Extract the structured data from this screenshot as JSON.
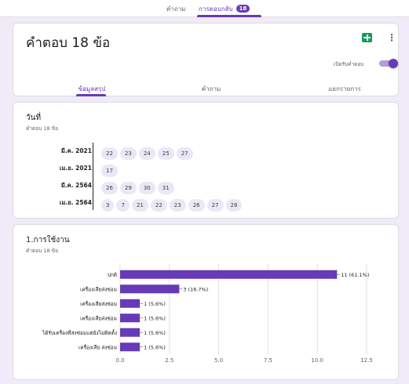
{
  "top_tabs": {
    "questions": "คำถาม",
    "responses": "การตอบกลับ",
    "responses_badge": "18"
  },
  "summary_card": {
    "title": "คำตอบ 18 ข้อ",
    "sheets_icon": "google-sheets-icon",
    "more_icon": "more-vert-icon",
    "accept_label": "เปิดรับคำตอบ",
    "accepting": true,
    "subtabs": [
      "ข้อมูลสรุป",
      "คำถาม",
      "แยกรายการ"
    ]
  },
  "date_question": {
    "title": "วันที่",
    "count": "คำตอบ 18 ข้อ",
    "rows": [
      {
        "label": "มี.ค. 2021",
        "days": [
          "22",
          "23",
          "24",
          "25",
          "27"
        ]
      },
      {
        "label": "เม.ย. 2021",
        "days": [
          "17"
        ]
      },
      {
        "label": "มี.ค. 2564",
        "days": [
          "26",
          "29",
          "30",
          "31"
        ]
      },
      {
        "label": "เม.ย. 2564",
        "days": [
          "3",
          "7",
          "21",
          "22",
          "23",
          "26",
          "27",
          "28"
        ]
      }
    ]
  },
  "usage_question": {
    "title": "1.การใช้งาน",
    "count": "คำตอบ 18 ข้อ"
  },
  "chart_data": {
    "type": "bar",
    "orientation": "horizontal",
    "categories": [
      "ปกติ",
      "เครื่องเสียส่งซ่อม",
      "เครื่องเสียส่งซ่อม",
      "เครื่องเสียส่งซ่อม",
      "ได้รับเครื่องที่ส่งซ่อมแต่ยังไม่ติดตั้ง",
      "เครื่องเสีย ส่งซ่อม"
    ],
    "values": [
      11,
      3,
      1,
      1,
      1,
      1
    ],
    "data_labels": [
      "11 (61.1%)",
      "3 (16.7%)",
      "1 (5.6%)",
      "1 (5.6%)",
      "1 (5.6%)",
      "1 (5.6%)"
    ],
    "xticks": [
      "0.0",
      "2.5",
      "5.0",
      "7.5",
      "10.0",
      "12.5"
    ],
    "xlim": [
      0,
      12.5
    ],
    "grid": true,
    "colors": {
      "bar": "#673ab7",
      "grid": "#e0e0e0"
    }
  },
  "colors": {
    "accent": "#673ab7",
    "background": "#f0ebf8"
  }
}
